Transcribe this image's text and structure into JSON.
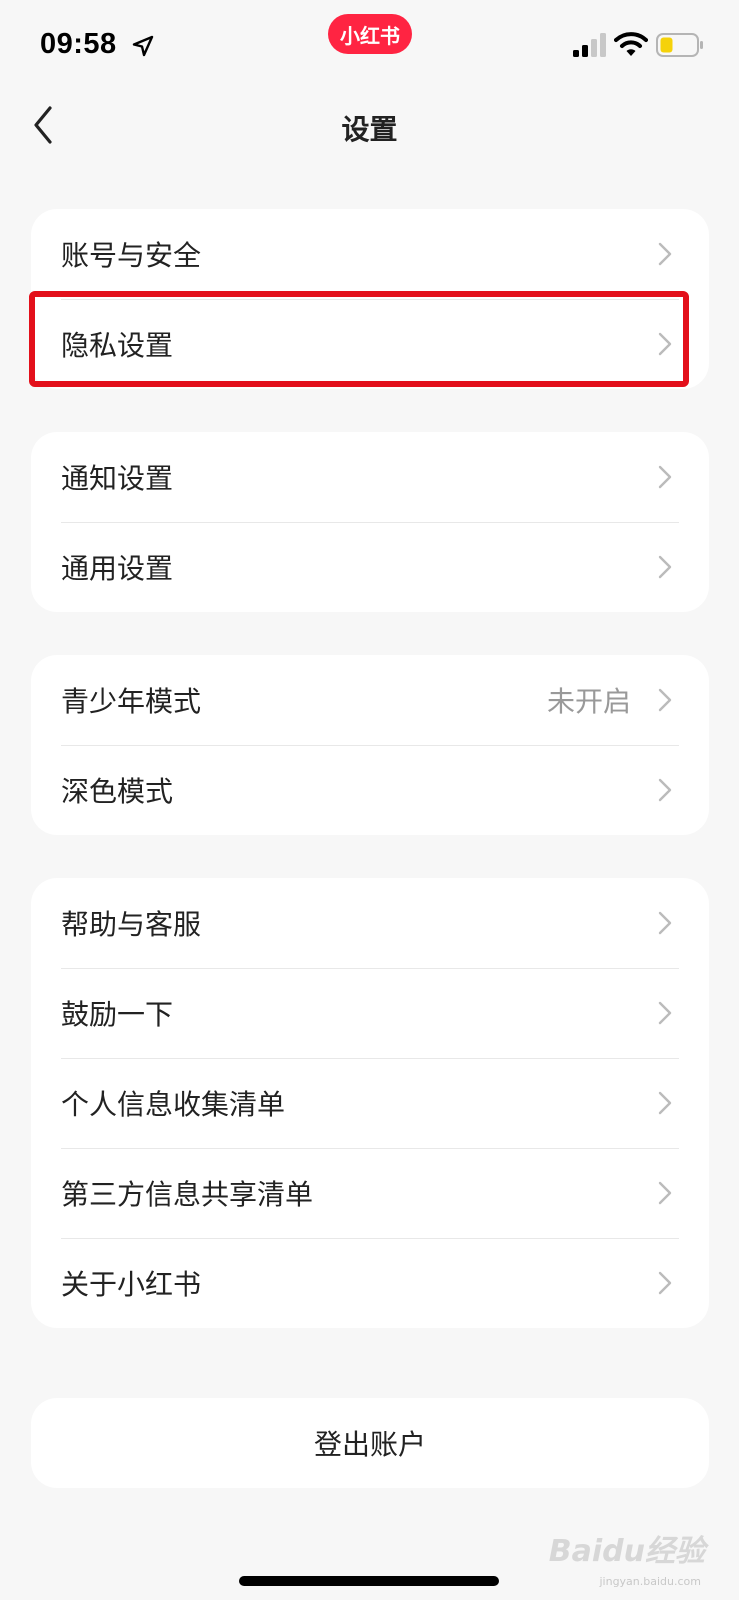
{
  "status_bar": {
    "time": "09:58",
    "app_badge": "小红书"
  },
  "header": {
    "title": "设置"
  },
  "groups": [
    {
      "items": [
        {
          "label": "账号与安全",
          "value": ""
        },
        {
          "label": "隐私设置",
          "value": ""
        }
      ]
    },
    {
      "items": [
        {
          "label": "通知设置",
          "value": ""
        },
        {
          "label": "通用设置",
          "value": ""
        }
      ]
    },
    {
      "items": [
        {
          "label": "青少年模式",
          "value": "未开启"
        },
        {
          "label": "深色模式",
          "value": ""
        }
      ]
    },
    {
      "items": [
        {
          "label": "帮助与客服",
          "value": ""
        },
        {
          "label": "鼓励一下",
          "value": ""
        },
        {
          "label": "个人信息收集清单",
          "value": ""
        },
        {
          "label": "第三方信息共享清单",
          "value": ""
        },
        {
          "label": "关于小红书",
          "value": ""
        }
      ]
    }
  ],
  "logout": {
    "label": "登出账户"
  },
  "watermark": {
    "text": "Baidu经验",
    "sub": "jingyan.baidu.com"
  },
  "colors": {
    "highlight": "#e3101b",
    "brand": "#ff2442"
  }
}
